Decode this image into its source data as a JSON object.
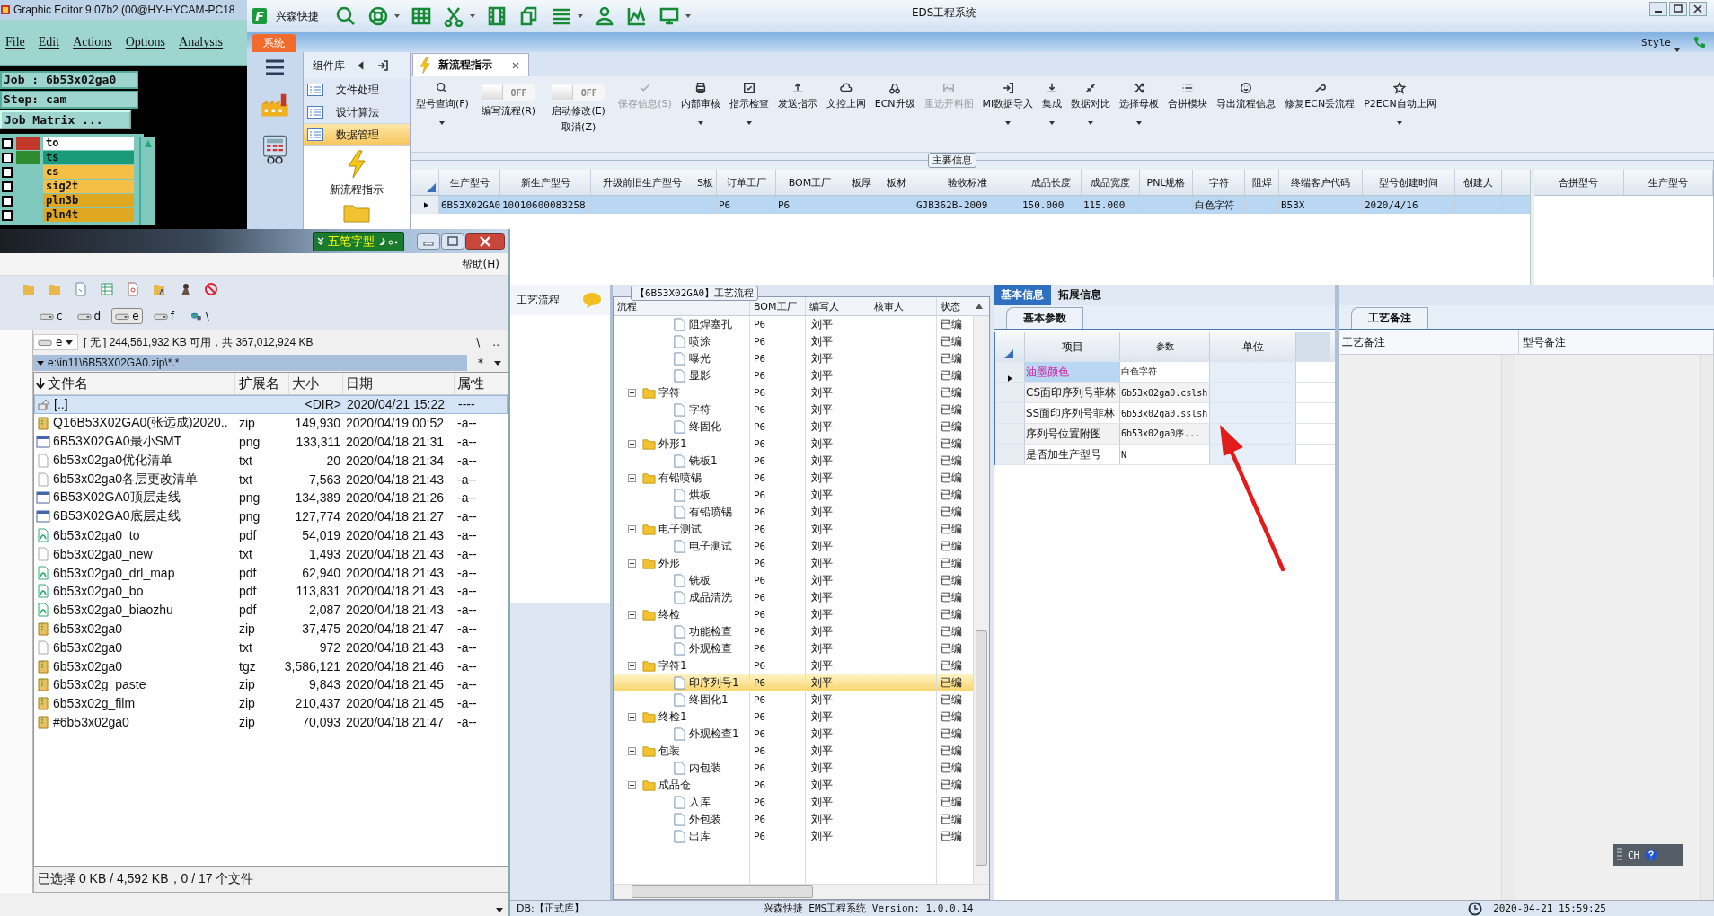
{
  "graphic_editor": {
    "title": "Graphic Editor 9.07b2 (00@HY-HYCAM-PC18",
    "menu": [
      "File",
      "Edit",
      "Actions",
      "Options",
      "Analysis"
    ],
    "job": "Job : 6b53x02ga0",
    "step": "Step: cam",
    "matrix_button": "Job Matrix ...",
    "layers": [
      {
        "name": "to",
        "color": "#ffffff",
        "checked": false,
        "swatch": {
          "color": "#c0392b"
        }
      },
      {
        "name": "ts",
        "color": "#1a9a78",
        "checked": false,
        "swatch": {
          "color": "#2e8b2e"
        }
      },
      {
        "name": "cs",
        "color": "#f5bf45",
        "checked": false
      },
      {
        "name": "sig2t",
        "color": "#f5bf45",
        "checked": false
      },
      {
        "name": "pln3b",
        "color": "#e0a820",
        "checked": false
      },
      {
        "name": "pln4t",
        "color": "#e0a820",
        "checked": false
      }
    ]
  },
  "eds": {
    "title": "EDS工程系统",
    "logo": "F",
    "quick_label": "兴森快捷",
    "ribbon_tab": "系统",
    "style_label": "Style",
    "nav_title": "组件库",
    "nav_items": [
      {
        "label": "文件处理",
        "selected": false
      },
      {
        "label": "设计算法",
        "selected": false
      },
      {
        "label": "数据管理",
        "selected": true
      }
    ],
    "nav_tool": "新流程指示",
    "doc_tab": "新流程指示",
    "ribbon": [
      {
        "kind": "button",
        "label": "型号查询(F)",
        "disabled": false,
        "dropdown": true
      },
      {
        "kind": "toggle",
        "label": "编写流程(R)",
        "switch_text": "OFF",
        "on": false
      },
      {
        "kind": "toggle",
        "label": "启动修改(E)",
        "sublabel": "取消(Z)",
        "switch_text": "OFF",
        "on": false
      },
      {
        "kind": "button",
        "label": "保存信息(S)",
        "disabled": true,
        "dropdown": false
      },
      {
        "kind": "button",
        "label": "内部审核",
        "disabled": false,
        "dropdown": true
      },
      {
        "kind": "button",
        "label": "指示检查",
        "disabled": false,
        "dropdown": true
      },
      {
        "kind": "button",
        "label": "发送指示",
        "disabled": false,
        "dropdown": false
      },
      {
        "kind": "button",
        "label": "文控上网",
        "disabled": false,
        "dropdown": false
      },
      {
        "kind": "button",
        "label": "ECN升级",
        "disabled": false,
        "dropdown": false
      },
      {
        "kind": "button",
        "label": "重选开料图",
        "disabled": true,
        "dropdown": false
      },
      {
        "kind": "button",
        "label": "MI数据导入",
        "disabled": false,
        "dropdown": true
      },
      {
        "kind": "button",
        "label": "集成",
        "disabled": false,
        "dropdown": true
      },
      {
        "kind": "button",
        "label": "数据对比",
        "disabled": false,
        "dropdown": true
      },
      {
        "kind": "button",
        "label": "选择母板",
        "disabled": false,
        "dropdown": true
      },
      {
        "kind": "button",
        "label": "合拼模块",
        "disabled": false,
        "dropdown": false
      },
      {
        "kind": "button",
        "label": "导出流程信息",
        "disabled": false,
        "dropdown": false
      },
      {
        "kind": "button",
        "label": "修复ECN丢流程",
        "disabled": false,
        "dropdown": false
      },
      {
        "kind": "button",
        "label": "P2ECN自动上网",
        "disabled": false,
        "dropdown": true
      }
    ],
    "main_info": {
      "title": "主要信息",
      "columns": [
        "生产型号",
        "新生产型号",
        "升级前旧生产型号",
        "S板",
        "订单工厂",
        "BOM工厂",
        "板厚",
        "板材",
        "验收标准",
        "成品长度",
        "成品宽度",
        "PNL规格",
        "字符",
        "阻焊",
        "终端客户代码",
        "型号创建时间",
        "创建人"
      ],
      "rows": [
        {
          "selected": true,
          "cells": [
            "6B53X02GA0",
            "10010600083258",
            "",
            "",
            "P6",
            "P6",
            "",
            "",
            "GJB362B-2009",
            "150.000",
            "115.000",
            "",
            "白色字符",
            "",
            "B53X",
            "2020/4/16",
            ""
          ]
        }
      ]
    },
    "merge_table": {
      "columns": [
        "合拼型号",
        "生产型号"
      ]
    },
    "process": {
      "side_title": "工艺流程",
      "group_title": "【6B53X02GA0】工艺流程",
      "columns": [
        "流程",
        "BOM工厂",
        "编写人",
        "核审人",
        "状态"
      ],
      "tree": [
        {
          "children": [
            {
              "label": "阻焊塞孔",
              "bom": "P6",
              "writer": "刘平",
              "status": "已编",
              "selected": false
            },
            {
              "label": "喷涂",
              "bom": "P6",
              "writer": "刘平",
              "status": "已编",
              "selected": false
            },
            {
              "label": "曝光",
              "bom": "P6",
              "writer": "刘平",
              "status": "已编",
              "selected": false
            },
            {
              "label": "显影",
              "bom": "P6",
              "writer": "刘平",
              "status": "已编",
              "selected": false
            }
          ]
        },
        {
          "label": "字符",
          "bom": "P6",
          "writer": "刘平",
          "status": "已编",
          "selected": false,
          "expanded": true,
          "children": [
            {
              "label": "字符",
              "bom": "P6",
              "writer": "刘平",
              "status": "已编",
              "selected": false
            },
            {
              "label": "终固化",
              "bom": "P6",
              "writer": "刘平",
              "status": "已编",
              "selected": false
            }
          ]
        },
        {
          "label": "外形1",
          "bom": "P6",
          "writer": "刘平",
          "status": "已编",
          "selected": false,
          "expanded": true,
          "children": [
            {
              "label": "铣板1",
              "bom": "P6",
              "writer": "刘平",
              "status": "已编",
              "selected": false
            }
          ]
        },
        {
          "label": "有铅喷锡",
          "bom": "P6",
          "writer": "刘平",
          "status": "已编",
          "selected": false,
          "expanded": true,
          "children": [
            {
              "label": "烘板",
              "bom": "P6",
              "writer": "刘平",
              "status": "已编",
              "selected": false
            },
            {
              "label": "有铅喷锡",
              "bom": "P6",
              "writer": "刘平",
              "status": "已编",
              "selected": false
            }
          ]
        },
        {
          "label": "电子测试",
          "bom": "P6",
          "writer": "刘平",
          "status": "已编",
          "selected": false,
          "expanded": true,
          "children": [
            {
              "label": "电子测试",
              "bom": "P6",
              "writer": "刘平",
              "status": "已编",
              "selected": false
            }
          ]
        },
        {
          "label": "外形",
          "bom": "P6",
          "writer": "刘平",
          "status": "已编",
          "selected": false,
          "expanded": true,
          "children": [
            {
              "label": "铣板",
              "bom": "P6",
              "writer": "刘平",
              "status": "已编",
              "selected": false
            },
            {
              "label": "成品清洗",
              "bom": "P6",
              "writer": "刘平",
              "status": "已编",
              "selected": false
            }
          ]
        },
        {
          "label": "终检",
          "bom": "P6",
          "writer": "刘平",
          "status": "已编",
          "selected": false,
          "expanded": true,
          "children": [
            {
              "label": "功能检查",
              "bom": "P6",
              "writer": "刘平",
              "status": "已编",
              "selected": false
            },
            {
              "label": "外观检查",
              "bom": "P6",
              "writer": "刘平",
              "status": "已编",
              "selected": false
            }
          ]
        },
        {
          "label": "字符1",
          "bom": "P6",
          "writer": "刘平",
          "status": "已编",
          "selected": false,
          "expanded": true,
          "children": [
            {
              "label": "印序列号1",
              "bom": "P6",
              "writer": "刘平",
              "status": "已编",
              "selected": true
            },
            {
              "label": "终固化1",
              "bom": "P6",
              "writer": "刘平",
              "status": "已编",
              "selected": false
            }
          ]
        },
        {
          "label": "终检1",
          "bom": "P6",
          "writer": "刘平",
          "status": "已编",
          "selected": false,
          "expanded": true,
          "children": [
            {
              "label": "外观检查1",
              "bom": "P6",
              "writer": "刘平",
              "status": "已编",
              "selected": false
            }
          ]
        },
        {
          "label": "包装",
          "bom": "P6",
          "writer": "刘平",
          "status": "已编",
          "selected": false,
          "expanded": true,
          "children": [
            {
              "label": "内包装",
              "bom": "P6",
              "writer": "刘平",
              "status": "已编",
              "selected": false
            }
          ]
        },
        {
          "label": "成品仓",
          "bom": "P6",
          "writer": "刘平",
          "status": "已编",
          "selected": false,
          "expanded": true,
          "children": [
            {
              "label": "入库",
              "bom": "P6",
              "writer": "刘平",
              "status": "已编",
              "selected": false
            },
            {
              "label": "外包装",
              "bom": "P6",
              "writer": "刘平",
              "status": "已编",
              "selected": false
            },
            {
              "label": "出库",
              "bom": "P6",
              "writer": "刘平",
              "status": "已编",
              "selected": false
            }
          ]
        }
      ]
    },
    "basic_info": {
      "tabs": [
        {
          "label": "基本信息",
          "selected": true
        },
        {
          "label": "拓展信息",
          "selected": false
        }
      ],
      "subtab": "基本参数",
      "columns": [
        "项目",
        "参数",
        "单位"
      ],
      "rows": [
        {
          "item": "油墨颜色",
          "value": "白色字符",
          "selected": true
        },
        {
          "item": "CS面印序列号菲林",
          "value": "6b53x02ga0.cslsh",
          "selected": false
        },
        {
          "item": "SS面印序列号菲林",
          "value": "6b53x02ga0.sslsh",
          "selected": false
        },
        {
          "item": "序列号位置附图",
          "value": "6b53x02ga0序...",
          "selected": false
        },
        {
          "item": "是否加生产型号",
          "value": "N",
          "selected": false
        }
      ]
    },
    "notes": {
      "tab": "工艺备注",
      "columns": [
        "工艺备注",
        "型号备注"
      ],
      "ime": "CH"
    },
    "status_bar": {
      "db": "DB:【正式库】",
      "version": "兴森快捷 EMS工程系统 Version: 1.0.0.14",
      "time": "2020-04-21 15:59:25"
    }
  },
  "file_manager": {
    "ime": "五笔字型",
    "menu": "帮助(H)",
    "drives": [
      {
        "label": "c",
        "selected": false
      },
      {
        "label": "d",
        "selected": false
      },
      {
        "label": "e",
        "selected": true
      },
      {
        "label": "f",
        "selected": false
      },
      {
        "label": "\\",
        "selected": false
      }
    ],
    "drive_select": "e",
    "free_info": "[ 无 ] 244,561,932 KB 可用，共 367,012,924 KB",
    "root_button": "\\",
    "up_button": "..",
    "path": "e:\\in11\\6B53X02GA0.zip\\*.*",
    "filter": "*",
    "columns": [
      "文件名",
      "扩展名",
      "大小",
      "日期",
      "属性"
    ],
    "rows": [
      {
        "kind": "up",
        "name": "[..]",
        "ext": "",
        "size": "<DIR>",
        "date": "2020/04/21 15:22",
        "attr": "----",
        "selected": true
      },
      {
        "kind": "zip",
        "name": "Q16B53X02GA0(张远成)2020..",
        "ext": "zip",
        "size": "149,930",
        "date": "2020/04/19 00:52",
        "attr": "-a--",
        "selected": false
      },
      {
        "kind": "image",
        "name": "6B53X02GA0最小SMT",
        "ext": "png",
        "size": "133,311",
        "date": "2020/04/18 21:31",
        "attr": "-a--",
        "selected": false
      },
      {
        "kind": "text",
        "name": "6b53x02ga0优化清单",
        "ext": "txt",
        "size": "20",
        "date": "2020/04/18 21:34",
        "attr": "-a--",
        "selected": false
      },
      {
        "kind": "text",
        "name": "6b53x02ga0各层更改清单",
        "ext": "txt",
        "size": "7,563",
        "date": "2020/04/18 21:43",
        "attr": "-a--",
        "selected": false
      },
      {
        "kind": "image",
        "name": "6B53X02GA0顶层走线",
        "ext": "png",
        "size": "134,389",
        "date": "2020/04/18 21:26",
        "attr": "-a--",
        "selected": false
      },
      {
        "kind": "image",
        "name": "6B53X02GA0底层走线",
        "ext": "png",
        "size": "127,774",
        "date": "2020/04/18 21:27",
        "attr": "-a--",
        "selected": false
      },
      {
        "kind": "pdf",
        "name": "6b53x02ga0_to",
        "ext": "pdf",
        "size": "54,019",
        "date": "2020/04/18 21:43",
        "attr": "-a--",
        "selected": false
      },
      {
        "kind": "text",
        "name": "6b53x02ga0_new",
        "ext": "txt",
        "size": "1,493",
        "date": "2020/04/18 21:43",
        "attr": "-a--",
        "selected": false
      },
      {
        "kind": "pdf",
        "name": "6b53x02ga0_drl_map",
        "ext": "pdf",
        "size": "62,940",
        "date": "2020/04/18 21:43",
        "attr": "-a--",
        "selected": false
      },
      {
        "kind": "pdf",
        "name": "6b53x02ga0_bo",
        "ext": "pdf",
        "size": "113,831",
        "date": "2020/04/18 21:43",
        "attr": "-a--",
        "selected": false
      },
      {
        "kind": "pdf",
        "name": "6b53x02ga0_biaozhu",
        "ext": "pdf",
        "size": "2,087",
        "date": "2020/04/18 21:43",
        "attr": "-a--",
        "selected": false
      },
      {
        "kind": "zip",
        "name": "6b53x02ga0",
        "ext": "zip",
        "size": "37,475",
        "date": "2020/04/18 21:47",
        "attr": "-a--",
        "selected": false
      },
      {
        "kind": "text",
        "name": "6b53x02ga0",
        "ext": "txt",
        "size": "972",
        "date": "2020/04/18 21:43",
        "attr": "-a--",
        "selected": false
      },
      {
        "kind": "zip",
        "name": "6b53x02ga0",
        "ext": "tgz",
        "size": "3,586,121",
        "date": "2020/04/18 21:46",
        "attr": "-a--",
        "selected": false
      },
      {
        "kind": "zip",
        "name": "6b53x02g_paste",
        "ext": "zip",
        "size": "9,843",
        "date": "2020/04/18 21:45",
        "attr": "-a--",
        "selected": false
      },
      {
        "kind": "zip",
        "name": "6b53x02g_film",
        "ext": "zip",
        "size": "210,437",
        "date": "2020/04/18 21:45",
        "attr": "-a--",
        "selected": false
      },
      {
        "kind": "zip",
        "name": "#6b53x02ga0",
        "ext": "zip",
        "size": "70,093",
        "date": "2020/04/18 21:47",
        "attr": "-a--",
        "selected": false
      }
    ],
    "status": "已选择 0 KB / 4,592 KB，0 / 17 个文件"
  }
}
